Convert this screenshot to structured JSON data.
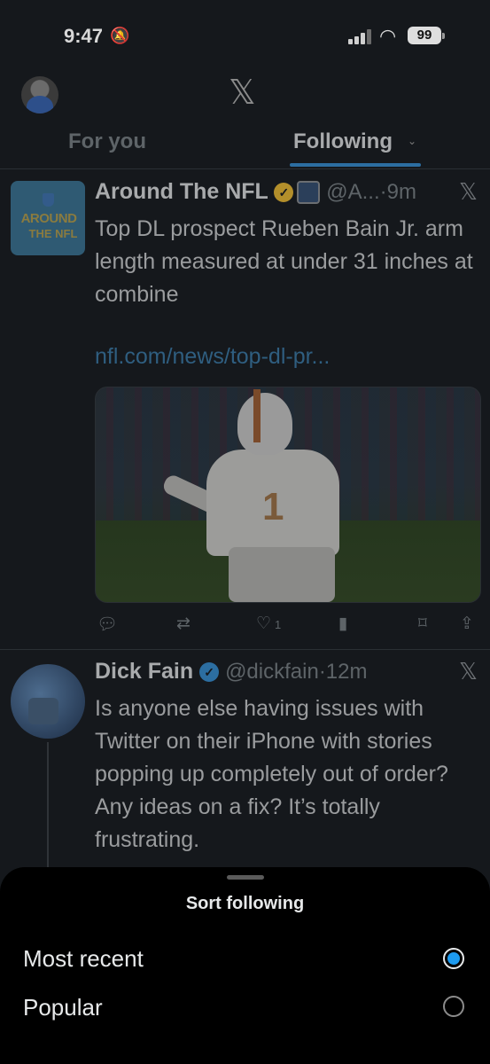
{
  "status": {
    "time": "9:47",
    "battery": "99"
  },
  "tabs": [
    {
      "label": "For you"
    },
    {
      "label": "Following"
    }
  ],
  "tweets": [
    {
      "name": "Around The NFL",
      "handle": "@A...",
      "time": "·9m",
      "text": "Top DL prospect Rueben Bain Jr. arm length measured at under 31 inches at combine",
      "link": "nfl.com/news/top-dl-pr...",
      "avatar_text": [
        "AROUND",
        "THE NFL"
      ],
      "likes": "1"
    },
    {
      "name": "Dick Fain",
      "handle": "@dickfain",
      "time": "·12m",
      "text": "Is anyone else having issues with Twitter on their iPhone with stories popping up completely out of order?  Any ideas on a fix?  It’s totally frustrating."
    }
  ],
  "sheet": {
    "title": "Sort following",
    "options": [
      {
        "label": "Most recent",
        "selected": true
      },
      {
        "label": "Popular",
        "selected": false
      }
    ]
  },
  "colors": {
    "accent": "#1d9bf0",
    "verified_gold": "#b38f2b"
  }
}
